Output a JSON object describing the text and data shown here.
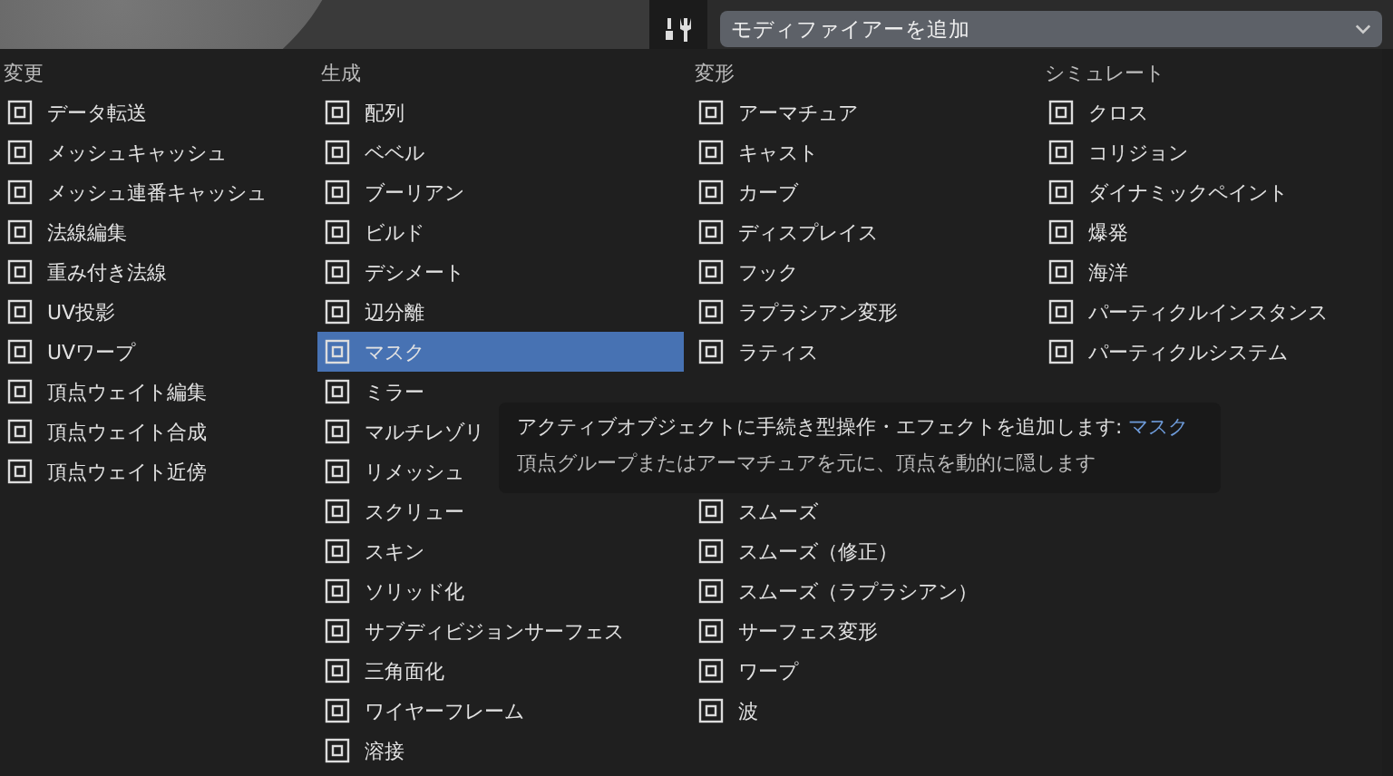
{
  "header": {
    "dropdown": "モディファイアーを追加"
  },
  "columns": [
    {
      "title": "変更",
      "sections": [
        [
          {
            "label": "データ転送",
            "selected": false
          },
          {
            "label": "メッシュキャッシュ",
            "selected": false
          },
          {
            "label": "メッシュ連番キャッシュ",
            "selected": false
          },
          {
            "label": "法線編集",
            "selected": false
          },
          {
            "label": "重み付き法線",
            "selected": false
          },
          {
            "label": "UV投影",
            "selected": false
          },
          {
            "label": "UVワープ",
            "selected": false
          },
          {
            "label": "頂点ウェイト編集",
            "selected": false
          },
          {
            "label": "頂点ウェイト合成",
            "selected": false
          },
          {
            "label": "頂点ウェイト近傍",
            "selected": false
          }
        ]
      ]
    },
    {
      "title": "生成",
      "sections": [
        [
          {
            "label": "配列",
            "selected": false
          },
          {
            "label": "ベベル",
            "selected": false
          },
          {
            "label": "ブーリアン",
            "selected": false
          },
          {
            "label": "ビルド",
            "selected": false
          },
          {
            "label": "デシメート",
            "selected": false
          },
          {
            "label": "辺分離",
            "selected": false
          },
          {
            "label": "マスク",
            "selected": true
          },
          {
            "label": "ミラー",
            "selected": false
          },
          {
            "label": "マルチレゾリ",
            "selected": false
          },
          {
            "label": "リメッシュ",
            "selected": false
          },
          {
            "label": "スクリュー",
            "selected": false
          },
          {
            "label": "スキン",
            "selected": false
          },
          {
            "label": "ソリッド化",
            "selected": false
          },
          {
            "label": "サブディビジョンサーフェス",
            "selected": false
          },
          {
            "label": "三角面化",
            "selected": false
          },
          {
            "label": "ワイヤーフレーム",
            "selected": false
          },
          {
            "label": "溶接",
            "selected": false
          }
        ]
      ]
    },
    {
      "title": "変形",
      "sections": [
        [
          {
            "label": "アーマチュア",
            "selected": false
          },
          {
            "label": "キャスト",
            "selected": false
          },
          {
            "label": "カーブ",
            "selected": false
          },
          {
            "label": "ディスプレイス",
            "selected": false
          },
          {
            "label": "フック",
            "selected": false
          },
          {
            "label": "ラプラシアン変形",
            "selected": false
          },
          {
            "label": "ラティス",
            "selected": false
          }
        ],
        [
          {
            "label": "スムーズ",
            "selected": false
          },
          {
            "label": "スムーズ（修正）",
            "selected": false
          },
          {
            "label": "スムーズ（ラプラシアン）",
            "selected": false
          },
          {
            "label": "サーフェス変形",
            "selected": false
          },
          {
            "label": "ワープ",
            "selected": false
          },
          {
            "label": "波",
            "selected": false
          }
        ]
      ]
    },
    {
      "title": "シミュレート",
      "sections": [
        [
          {
            "label": "クロス",
            "selected": false
          },
          {
            "label": "コリジョン",
            "selected": false
          },
          {
            "label": "ダイナミックペイント",
            "selected": false
          },
          {
            "label": "爆発",
            "selected": false
          },
          {
            "label": "海洋",
            "selected": false
          },
          {
            "label": "パーティクルインスタンス",
            "selected": false
          },
          {
            "label": "パーティクルシステム",
            "selected": false
          }
        ]
      ]
    }
  ],
  "tooltip": {
    "text": "アクティブオブジェクトに手続き型操作・エフェクトを追加します:",
    "name": "マスク",
    "description": "頂点グループまたはアーマチュアを元に、頂点を動的に隠します"
  }
}
